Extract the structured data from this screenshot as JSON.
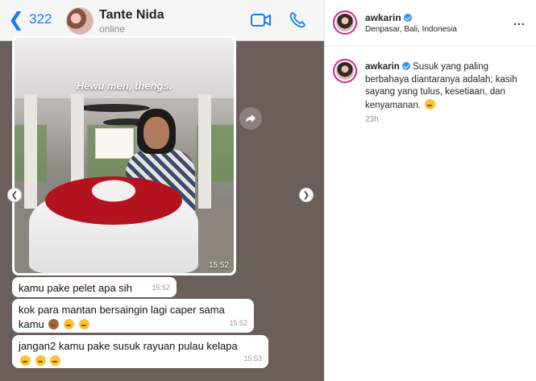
{
  "chat": {
    "back_count": "322",
    "contact_name": "Tante Nida",
    "contact_status": "online",
    "photo_caption": "Hewu men, thengs.",
    "photo_time": "15:52",
    "messages": [
      {
        "text": "kamu pake pelet apa sih",
        "time": "15:52",
        "emojis": []
      },
      {
        "text": "kok para mantan bersaingin lagi caper sama kamu",
        "time": "15:52",
        "emojis": [
          "see-no-evil-monkey",
          "zany-face",
          "zany-face"
        ]
      },
      {
        "text": "jangan2 kamu pake susuk rayuan pulau kelapa",
        "time": "15:53",
        "emojis": [
          "zany-face",
          "zany-face",
          "zany-face"
        ]
      }
    ]
  },
  "instagram": {
    "username": "awkarin",
    "location": "Denpasar, Bali, Indonesia",
    "more_label": "...",
    "caption_username": "awkarin",
    "caption_text": "Susuk yang paling berbahaya diantaranya adalah; kasih sayang yang tulus, kesetiaan, dan kenyamanan.",
    "caption_emoji": "winking-face-with-tongue",
    "time_ago": "23h"
  },
  "colors": {
    "ios_blue": "#1a7cf0",
    "chat_background": "#6b5f5c",
    "verified_badge": "#3897f0",
    "story_ring": "#d6249f"
  }
}
